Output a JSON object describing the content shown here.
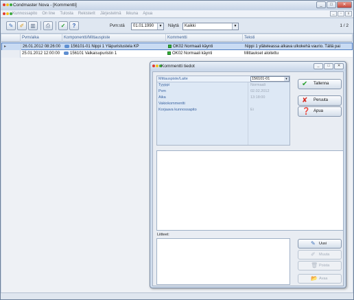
{
  "window": {
    "title": "Condmaster Nova - [Kommentti]",
    "buttons": {
      "minimize": "_",
      "maximize": "□",
      "close": "✕"
    }
  },
  "menu": {
    "items": [
      "Kunnossapito",
      "On line",
      "Tulosta",
      "Rekisterit",
      "Järjestelmä",
      "Ikkuna",
      "Apua"
    ],
    "mdi": {
      "minimize": "_",
      "restore": "▫",
      "close": "x"
    }
  },
  "toolbar": {
    "date_label": "Pvm:stä",
    "date_value": "01.01.1990",
    "show_label": "Näytä",
    "show_value": "Kaikki",
    "page": "1 / 2"
  },
  "grid": {
    "headers": [
      "Pvm/aika",
      "Komponentti/Mittauspiste",
      "Kommentti",
      "Teksti"
    ],
    "rows": [
      {
        "date": "26.01.2012 08:26:00",
        "point": "156101-01  Nippi 1 Yläpuristustela KP",
        "comment": "OK02  Normaali käynti",
        "text": "Nippi 1 yläteleassa alkava ulkokehä vaurio. Tällä pai",
        "selected": true
      },
      {
        "date": "25.01.2012 12:00:00",
        "point": "156101  Valkaisupuristin 1",
        "comment": "OK02  Normaali käynti",
        "text": "Mittaukset aloitettu",
        "selected": false
      }
    ]
  },
  "dialog": {
    "title": "Kommentti tiedot",
    "props": [
      {
        "key": "Mittauspiste/Laite",
        "value": "156101-01"
      },
      {
        "key": "Tyyppi",
        "value": "Normaali"
      },
      {
        "key": "Pvm",
        "value": "02.02.2012"
      },
      {
        "key": "Aika",
        "value": "13:18:00"
      },
      {
        "key": "Vakiokommentti",
        "value": ""
      },
      {
        "key": "Korjaava kunnossapito",
        "value": "Ei"
      }
    ],
    "buttons": {
      "save": "Tallenna",
      "cancel": "Peruuta",
      "help": "Apua"
    },
    "attachments_label": "Liitteet:",
    "att_buttons": {
      "new": "Uusi",
      "edit": "Muuta",
      "delete": "Poista",
      "open": "Avaa"
    }
  },
  "colors": {
    "accent": "#4f7ec4",
    "status_ok": "#34b03a",
    "close": "#c6473a"
  }
}
